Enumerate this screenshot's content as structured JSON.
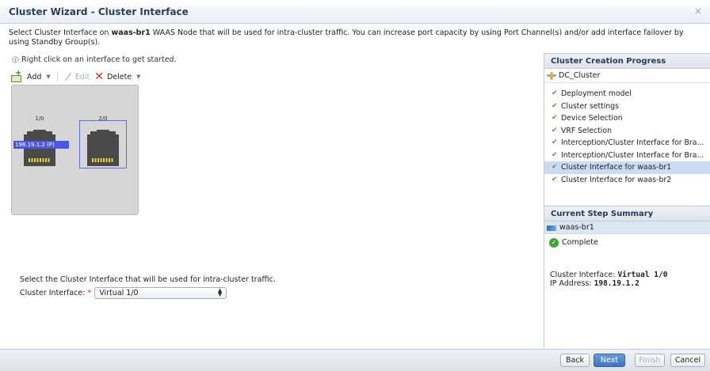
{
  "window": {
    "title": "Cluster Wizard - Cluster Interface",
    "close_glyph": "×"
  },
  "intro": {
    "prefix": "Select Cluster Interface on ",
    "node": "waas-br1",
    "suffix": " WAAS Node that will be used for intra-cluster traffic. You can increase port capacity by using Port Channel(s) and/or add interface failover by using Standby Group(s)."
  },
  "hint": {
    "icon": "info-icon",
    "text": "Right click on an interface to get started."
  },
  "toolbar": {
    "add_label": "Add",
    "edit_label": "Edit",
    "delete_label": "Delete"
  },
  "ports": [
    {
      "label": "1/0",
      "ip": "198.19.1.2 (P)"
    },
    {
      "label": "2/0"
    }
  ],
  "form": {
    "instruction": "Select the Cluster Interface that will be used for intra-cluster traffic.",
    "field_label": "Cluster Interface:",
    "required_mark": "*",
    "selected_value": "Virtual 1/0"
  },
  "progress": {
    "heading": "Cluster Creation Progress",
    "cluster_name": "DC_Cluster",
    "steps": [
      {
        "label": "Deployment model"
      },
      {
        "label": "Cluster settings"
      },
      {
        "label": "Device Selection"
      },
      {
        "label": "VRF Selection"
      },
      {
        "label": "Interception/Cluster Interface for Bra..."
      },
      {
        "label": "Interception/Cluster Interface for Bra..."
      },
      {
        "label": "Cluster Interface for waas-br1",
        "active": true
      },
      {
        "label": "Cluster Interface for waas-br2"
      }
    ]
  },
  "summary": {
    "heading": "Current Step Summary",
    "node": "waas-br1",
    "status": "Complete",
    "interface_label": "Cluster Interface:",
    "interface_value": "Virtual 1/0",
    "ip_label": "IP Address:",
    "ip_value": "198.19.1.2"
  },
  "footer": {
    "back": "Back",
    "next": "Next",
    "finish": "Finish",
    "cancel": "Cancel"
  }
}
